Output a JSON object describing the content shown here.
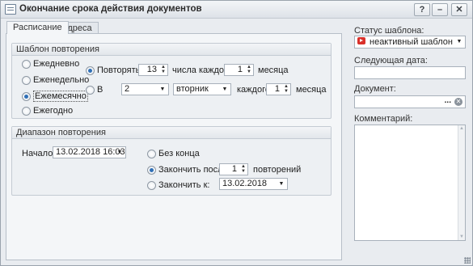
{
  "window": {
    "title": "Окончание срока действия документов",
    "buttons": {
      "help": "?",
      "minimize": "–",
      "close": "✕"
    }
  },
  "tabs": [
    {
      "label": "Расписание"
    },
    {
      "label": "Адреса"
    }
  ],
  "pattern": {
    "heading": "Шаблон повторения",
    "types": [
      "Ежедневно",
      "Еженедельно",
      "Ежемесячно",
      "Ежегодно"
    ],
    "selected_type": "Ежемесячно",
    "repeat_label": "Повторять",
    "day_value": "13",
    "day_of_every_label": "числа каждого",
    "month_value": "1",
    "month_label": "месяца",
    "in_label": "В",
    "ordinal_value": "2",
    "weekday_value": "вторник",
    "every_label": "каждого",
    "month_value2": "1",
    "month_label2": "месяца"
  },
  "range": {
    "heading": "Диапазон повторения",
    "start_label": "Начало:",
    "start_value": "13.02.2018 16:03",
    "no_end_label": "Без конца",
    "end_after_label": "Закончить после:",
    "end_after_count": "1",
    "occurrences_label": "повторений",
    "end_by_label": "Закончить к:",
    "end_by_value": "13.02.2018"
  },
  "side": {
    "status_label": "Статус шаблона:",
    "status_value": "неактивный шаблон",
    "next_date_label": "Следующая дата:",
    "next_date_value": "",
    "document_label": "Документ:",
    "document_value": "",
    "document_browse": "...",
    "comment_label": "Комментарий:",
    "comment_value": ""
  },
  "colors": {
    "status_icon": "#d9302a",
    "radio_selected": "#2f6fb6"
  }
}
